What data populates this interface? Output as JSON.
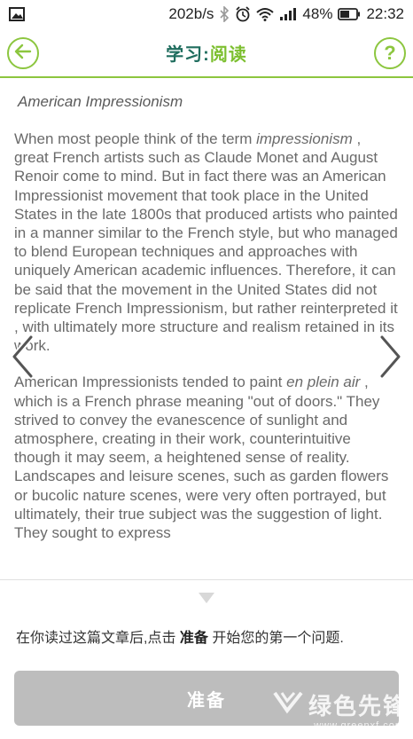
{
  "status_bar": {
    "speed": "202b/s",
    "battery": "48%",
    "time": "22:32",
    "icons": [
      "image-icon",
      "bluetooth-icon",
      "alarm-icon",
      "wifi-icon",
      "signal-icon",
      "battery-icon"
    ]
  },
  "header": {
    "title_prefix": "学习:",
    "title_main": "阅读",
    "help_label": "?",
    "accent_color": "#8cc63f"
  },
  "article": {
    "title": "American Impressionism",
    "p1_a": "When most people think of the term ",
    "p1_em": "impressionism",
    "p1_b": " , great French artists such as Claude Monet and August Renoir come to mind. But in fact there was an American Impressionist movement that took place in the United States in the late 1800s that produced artists who painted in a manner similar to the French style, but who managed to blend European techniques and approaches with uniquely American academic influences. Therefore, it can be said that the movement in the United States did not replicate French Impressionism, but rather reinterpreted it , with ultimately more structure and realism retained in its work.",
    "p2_a": "American Impressionists tended to paint ",
    "p2_em": "en plein air",
    "p2_b": " , which is a French phrase meaning \"out of doors.\" They strived to convey the evanescence of sunlight and atmosphere, creating in their work, counterintuitive though it may seem, a heightened sense of reality. Landscapes and leisure scenes, such as garden flowers or bucolic nature scenes, were very often portrayed, but ultimately, their true subject was the suggestion of light. They sought to express"
  },
  "footer": {
    "instruction_a": "在你读过这篇文章后,点击 ",
    "instruction_b": "准备",
    "instruction_c": " 开始您的第一个问题.",
    "ready_label": "准备"
  },
  "watermark": {
    "text": "绿色先锋",
    "sub": "www.greenxf.com"
  }
}
